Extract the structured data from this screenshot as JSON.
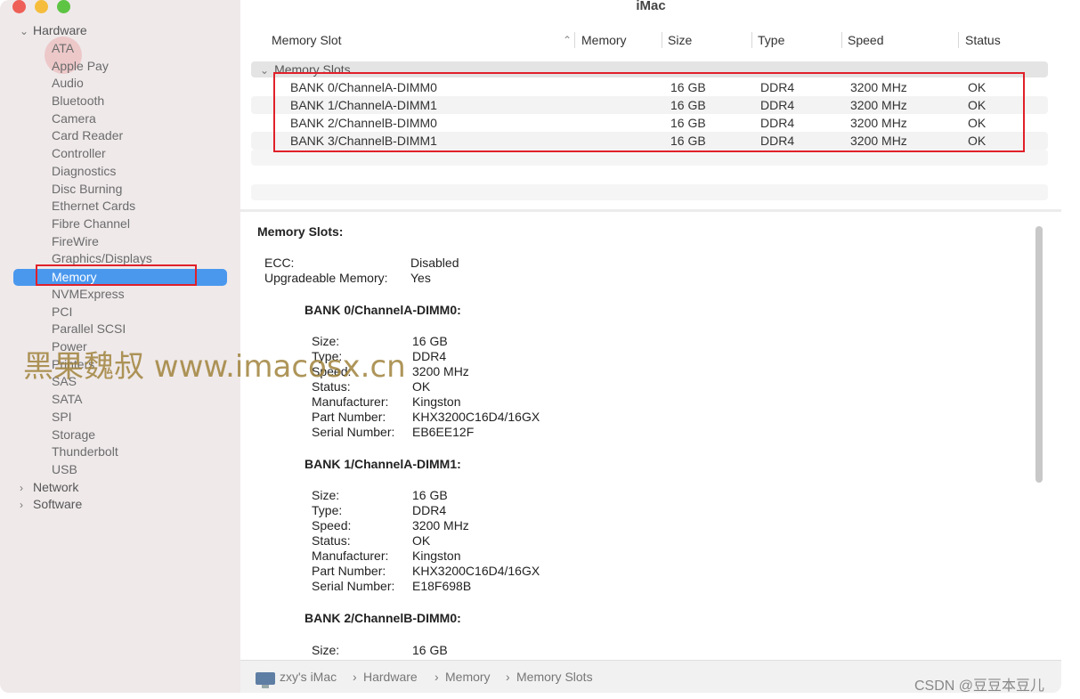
{
  "window": {
    "title": "iMac"
  },
  "sidebar": {
    "hardware_label": "Hardware",
    "items": [
      "ATA",
      "Apple Pay",
      "Audio",
      "Bluetooth",
      "Camera",
      "Card Reader",
      "Controller",
      "Diagnostics",
      "Disc Burning",
      "Ethernet Cards",
      "Fibre Channel",
      "FireWire",
      "Graphics/Displays",
      "Memory",
      "NVMExpress",
      "PCI",
      "Parallel SCSI",
      "Power",
      "Printers",
      "SAS",
      "SATA",
      "SPI",
      "Storage",
      "Thunderbolt",
      "USB"
    ],
    "selected": "Memory",
    "network_label": "Network",
    "software_label": "Software"
  },
  "table": {
    "headers": [
      "Memory Slot",
      "Memory",
      "Size",
      "Type",
      "Speed",
      "Status"
    ],
    "group_label": "Memory Slots",
    "rows": [
      {
        "slot": "BANK 0/ChannelA-DIMM0",
        "size": "16 GB",
        "type": "DDR4",
        "speed": "3200 MHz",
        "status": "OK"
      },
      {
        "slot": "BANK 1/ChannelA-DIMM1",
        "size": "16 GB",
        "type": "DDR4",
        "speed": "3200 MHz",
        "status": "OK"
      },
      {
        "slot": "BANK 2/ChannelB-DIMM0",
        "size": "16 GB",
        "type": "DDR4",
        "speed": "3200 MHz",
        "status": "OK"
      },
      {
        "slot": "BANK 3/ChannelB-DIMM1",
        "size": "16 GB",
        "type": "DDR4",
        "speed": "3200 MHz",
        "status": "OK"
      }
    ]
  },
  "detail": {
    "heading": "Memory Slots:",
    "ecc_label": "ECC:",
    "ecc_value": "Disabled",
    "upgradeable_label": "Upgradeable Memory:",
    "upgradeable_value": "Yes",
    "field_labels": {
      "size": "Size:",
      "type": "Type:",
      "speed": "Speed:",
      "status": "Status:",
      "manufacturer": "Manufacturer:",
      "part": "Part Number:",
      "serial": "Serial Number:"
    },
    "banks": [
      {
        "name": "BANK 0/ChannelA-DIMM0:",
        "size": "16 GB",
        "type": "DDR4",
        "speed": "3200 MHz",
        "status": "OK",
        "manufacturer": "Kingston",
        "part": "KHX3200C16D4/16GX",
        "serial": "EB6EE12F"
      },
      {
        "name": "BANK 1/ChannelA-DIMM1:",
        "size": "16 GB",
        "type": "DDR4",
        "speed": "3200 MHz",
        "status": "OK",
        "manufacturer": "Kingston",
        "part": "KHX3200C16D4/16GX",
        "serial": "E18F698B"
      },
      {
        "name": "BANK 2/ChannelB-DIMM0:",
        "size": "16 GB"
      }
    ]
  },
  "statusbar": {
    "path": [
      "zxy's iMac",
      "Hardware",
      "Memory",
      "Memory Slots"
    ],
    "separator": "›"
  },
  "overlay": {
    "watermark": "黑果魏叔 www.imacosx.cn",
    "csdn": "CSDN @豆豆本豆儿"
  },
  "colors": {
    "selection": "#4a98ee",
    "highlight_box": "#e0202a",
    "sidebar_bg": "#efe9ea"
  }
}
